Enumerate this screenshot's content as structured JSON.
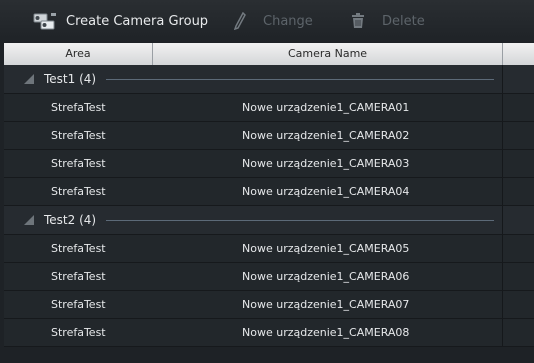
{
  "toolbar": {
    "create_label": "Create Camera Group",
    "change_label": "Change",
    "delete_label": "Delete"
  },
  "columns": {
    "area": "Area",
    "camera_name": "Camera Name"
  },
  "groups": [
    {
      "name": "Test1 (4)",
      "rows": [
        {
          "area": "StrefaTest",
          "camera": "Nowe urządzenie1_CAMERA01"
        },
        {
          "area": "StrefaTest",
          "camera": "Nowe urządzenie1_CAMERA02"
        },
        {
          "area": "StrefaTest",
          "camera": "Nowe urządzenie1_CAMERA03"
        },
        {
          "area": "StrefaTest",
          "camera": "Nowe urządzenie1_CAMERA04"
        }
      ]
    },
    {
      "name": "Test2 (4)",
      "rows": [
        {
          "area": "StrefaTest",
          "camera": "Nowe urządzenie1_CAMERA05"
        },
        {
          "area": "StrefaTest",
          "camera": "Nowe urządzenie1_CAMERA06"
        },
        {
          "area": "StrefaTest",
          "camera": "Nowe urządzenie1_CAMERA07"
        },
        {
          "area": "StrefaTest",
          "camera": "Nowe urządzenie1_CAMERA08"
        }
      ]
    }
  ]
}
